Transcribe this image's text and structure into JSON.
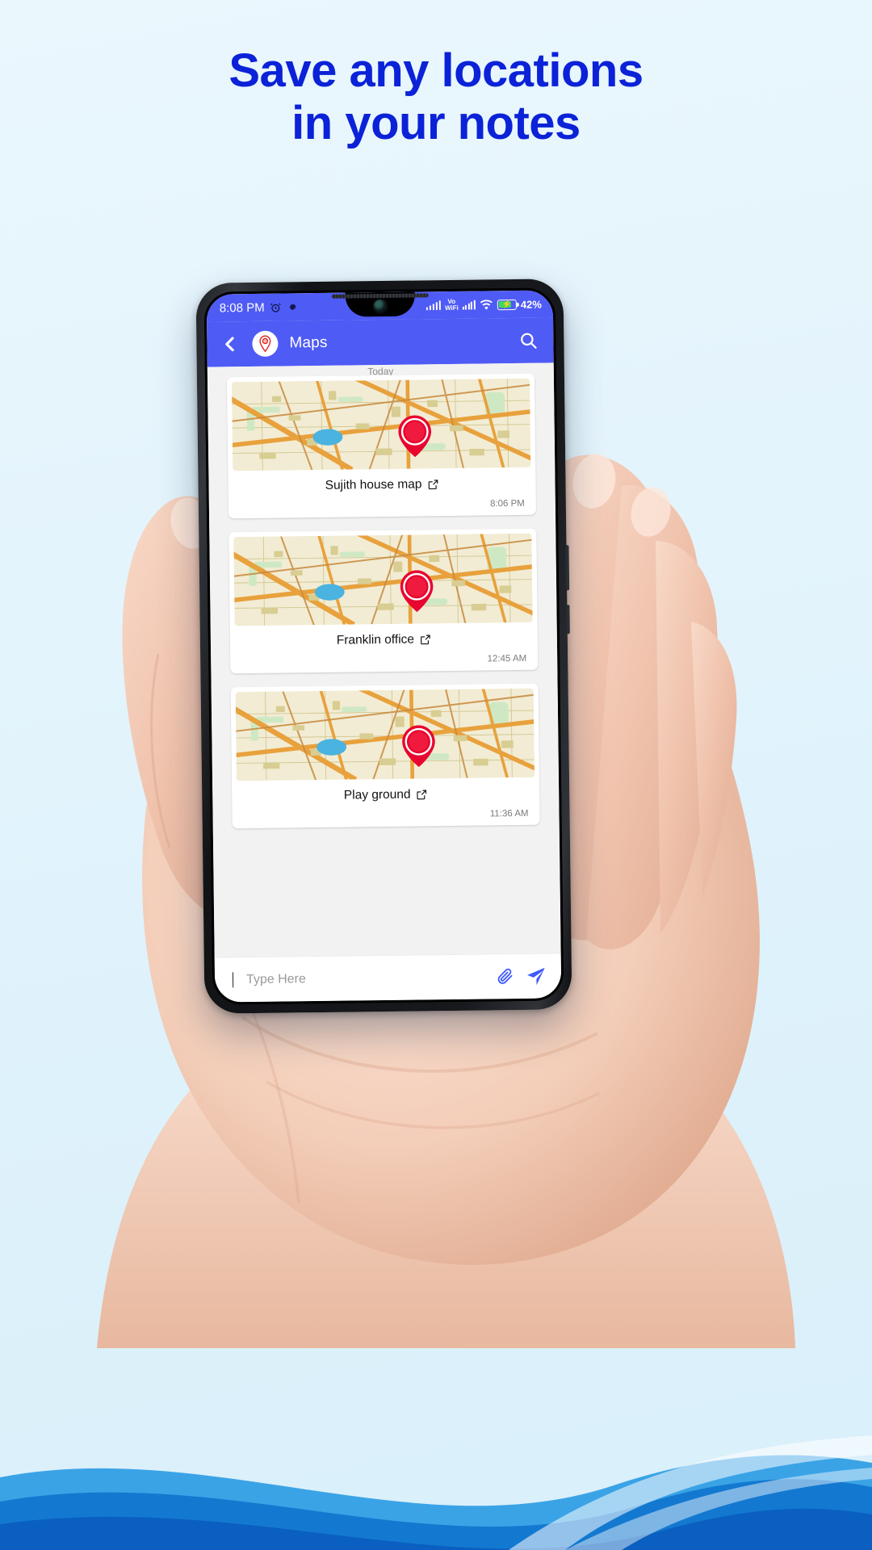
{
  "promo": {
    "headline_line1": "Save any locations",
    "headline_line2": "in your notes",
    "headline_color": "#0b22d8",
    "background_color": "#e4f4fc",
    "wave_color": "#1a8fe0"
  },
  "phone": {
    "status_bar": {
      "time": "8:08 PM",
      "alarm_icon": "alarm-clock-icon",
      "settings_icon": "gear-icon",
      "signal_label": "signal-bars-icon",
      "vowifi_line1": "Vo",
      "vowifi_line2": "WiFi",
      "wifi_icon": "wifi-icon",
      "battery_icon": "battery-charging-icon",
      "battery_percent": "42%",
      "background_color": "#4f5bf5"
    },
    "app_bar": {
      "back_icon": "chevron-left-icon",
      "logo_icon": "map-pin-logo-icon",
      "title": "Maps",
      "search_icon": "search-icon",
      "background_color": "#4f5bf5"
    },
    "chat": {
      "day_divider": "Today",
      "cards": [
        {
          "title": "Sujith house map",
          "time": "8:06 PM",
          "open_icon": "external-link-icon",
          "thumbnail": "map-thumbnail-with-red-pin"
        },
        {
          "title": "Franklin office",
          "time": "12:45 AM",
          "open_icon": "external-link-icon",
          "thumbnail": "map-thumbnail-with-red-pin"
        },
        {
          "title": "Play ground",
          "time": "11:36 AM",
          "open_icon": "external-link-icon",
          "thumbnail": "map-thumbnail-with-red-pin"
        }
      ]
    },
    "input_bar": {
      "placeholder": "Type Here",
      "value": "",
      "attach_icon": "paperclip-icon",
      "send_icon": "send-paper-plane-icon",
      "send_color": "#3d5afe"
    }
  }
}
